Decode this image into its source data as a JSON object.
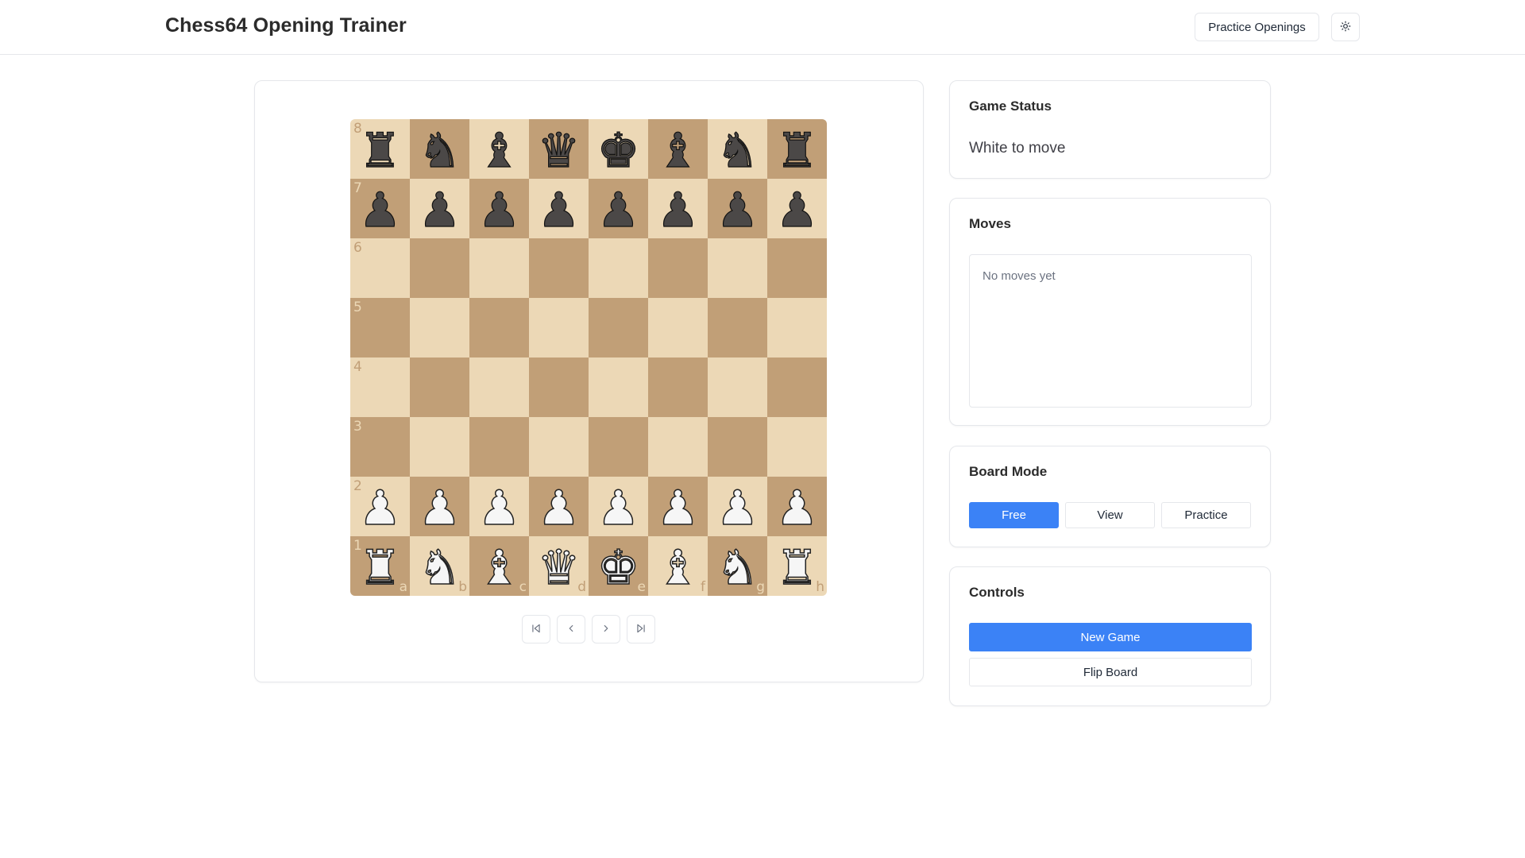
{
  "header": {
    "title": "Chess64 Opening Trainer",
    "practice_label": "Practice Openings",
    "theme_icon": "sun-icon"
  },
  "board": {
    "colors": {
      "light": "#ecd8b6",
      "dark": "#c19f77"
    },
    "ranks": [
      "8",
      "7",
      "6",
      "5",
      "4",
      "3",
      "2",
      "1"
    ],
    "files": [
      "a",
      "b",
      "c",
      "d",
      "e",
      "f",
      "g",
      "h"
    ],
    "position": [
      [
        "r",
        "n",
        "b",
        "q",
        "k",
        "b",
        "n",
        "r"
      ],
      [
        "p",
        "p",
        "p",
        "p",
        "p",
        "p",
        "p",
        "p"
      ],
      [
        "",
        "",
        "",
        "",
        "",
        "",
        "",
        ""
      ],
      [
        "",
        "",
        "",
        "",
        "",
        "",
        "",
        ""
      ],
      [
        "",
        "",
        "",
        "",
        "",
        "",
        "",
        ""
      ],
      [
        "",
        "",
        "",
        "",
        "",
        "",
        "",
        ""
      ],
      [
        "P",
        "P",
        "P",
        "P",
        "P",
        "P",
        "P",
        "P"
      ],
      [
        "R",
        "N",
        "B",
        "Q",
        "K",
        "B",
        "N",
        "R"
      ]
    ],
    "nav_icons": [
      "skip-back-icon",
      "chevron-left-icon",
      "chevron-right-icon",
      "skip-forward-icon"
    ]
  },
  "status": {
    "title": "Game Status",
    "text": "White to move"
  },
  "moves": {
    "title": "Moves",
    "empty_text": "No moves yet"
  },
  "mode": {
    "title": "Board Mode",
    "options": [
      "Free",
      "View",
      "Practice"
    ],
    "selected": "Free"
  },
  "controls": {
    "title": "Controls",
    "new_game_label": "New Game",
    "flip_board_label": "Flip Board"
  },
  "colors": {
    "accent": "#3b82f6",
    "border": "#e5e7eb"
  }
}
